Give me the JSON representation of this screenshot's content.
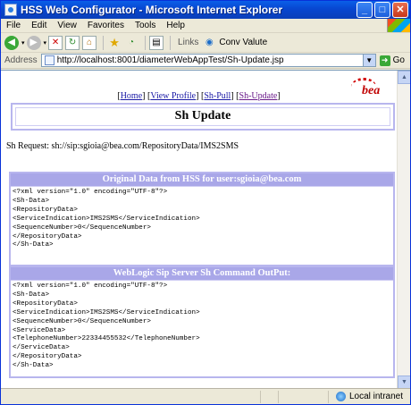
{
  "window": {
    "title": "HSS Web Configurator - Microsoft Internet Explorer"
  },
  "menu": [
    "File",
    "Edit",
    "View",
    "Favorites",
    "Tools",
    "Help"
  ],
  "toolbar": {
    "links_label": "Links",
    "conv_label": "Conv Valute"
  },
  "address": {
    "label": "Address",
    "url": "http://localhost:8001/diameterWebAppTest/Sh-Update.jsp",
    "go_label": "Go"
  },
  "page": {
    "nav": {
      "open1": "[",
      "home": "Home",
      "close1": "] ",
      "open2": "[",
      "view_profile": "View Profile",
      "close2": "] ",
      "open3": "[",
      "sh_pull": "Sh-Pull",
      "close3": "] ",
      "open4": "[",
      "sh_update": "Sh-Update",
      "close4": "]"
    },
    "logo_text": "bea",
    "heading": "Sh Update",
    "sh_request": "Sh Request: sh://sip:sgioia@bea.com/RepositoryData/IMS2SMS",
    "original_header": "Original Data from HSS for user:sgioia@bea.com",
    "original_xml": "<?xml version=\"1.0\" encoding=\"UTF-8\"?>\n<Sh-Data>\n<RepositoryData>\n<ServiceIndication>IMS2SMS</ServiceIndication>\n<SequenceNumber>0</SequenceNumber>\n</RepositoryData>\n</Sh-Data>",
    "output_header": "WebLogic Sip Server Sh Command OutPut:",
    "output_xml": "<?xml version=\"1.0\" encoding=\"UTF-8\"?>\n<Sh-Data>\n<RepositoryData>\n<ServiceIndication>IMS2SMS</ServiceIndication>\n<SequenceNumber>0</SequenceNumber>\n<ServiceData>\n<TelephoneNumber>22334455532</TelephoneNumber>\n</ServiceData>\n</RepositoryData>\n</Sh-Data>"
  },
  "status": {
    "zone": "Local intranet"
  }
}
